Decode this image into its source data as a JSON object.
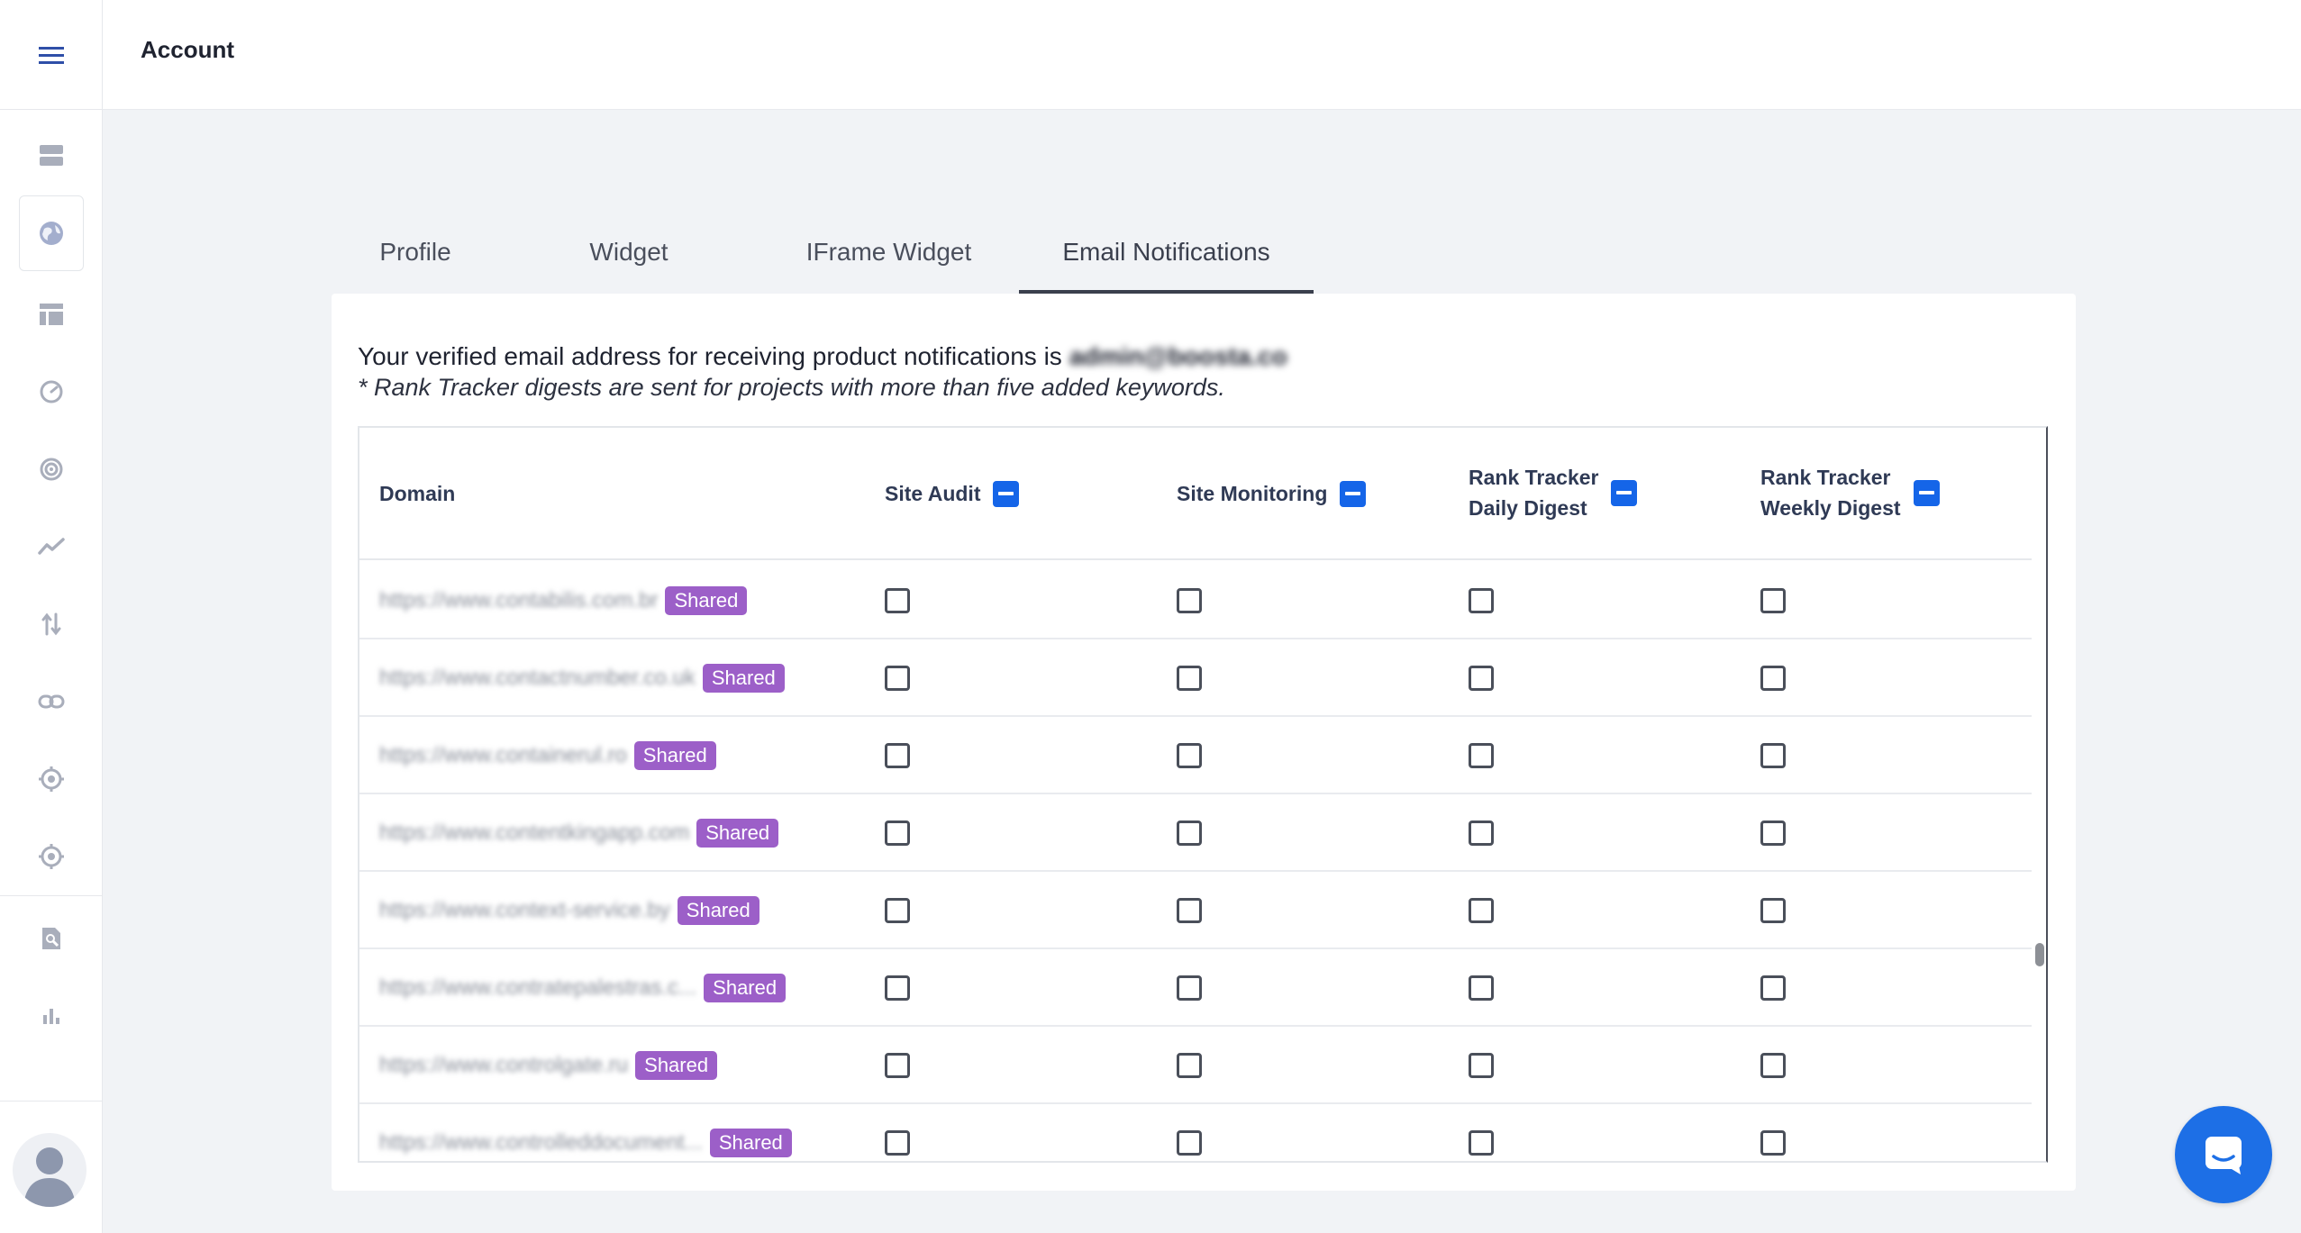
{
  "header": {
    "title": "Account"
  },
  "sidebar": {
    "icons": [
      "menu-icon",
      "server-icon",
      "globe-icon",
      "table-icon",
      "gauge-icon",
      "radar-icon",
      "trend-icon",
      "sort-icon",
      "link-icon",
      "target-icon",
      "target-alt-icon",
      "search-doc-icon",
      "bar-chart-icon"
    ]
  },
  "tabs": [
    {
      "label": "Profile",
      "active": false
    },
    {
      "label": "Widget",
      "active": false
    },
    {
      "label": "IFrame Widget",
      "active": false
    },
    {
      "label": "Email Notifications",
      "active": true
    }
  ],
  "intro": {
    "text": "Your verified email address for receiving product notifications is",
    "email": "admin@boosta.co",
    "note": "* Rank Tracker digests are sent for projects with more than five added keywords."
  },
  "table": {
    "columns": {
      "domain": "Domain",
      "site_audit": "Site Audit",
      "site_monitoring": "Site Monitoring",
      "rank_daily_1": "Rank Tracker",
      "rank_daily_2": "Daily Digest",
      "rank_weekly_1": "Rank Tracker",
      "rank_weekly_2": "Weekly Digest"
    },
    "badge_label": "Shared",
    "rows": [
      {
        "domain": "https://www.contabilis.com.br"
      },
      {
        "domain": "https://www.contactnumber.co.uk"
      },
      {
        "domain": "https://www.containerul.ro"
      },
      {
        "domain": "https://www.contentkingapp.com"
      },
      {
        "domain": "https://www.context-service.by"
      },
      {
        "domain": "https://www.contratepalestras.c..."
      },
      {
        "domain": "https://www.controlgate.ru"
      },
      {
        "domain": "https://www.controlleddocument..."
      }
    ]
  },
  "colors": {
    "accent": "#1565e8",
    "badge": "#9c5fc8",
    "chat": "#1d6fe6"
  }
}
